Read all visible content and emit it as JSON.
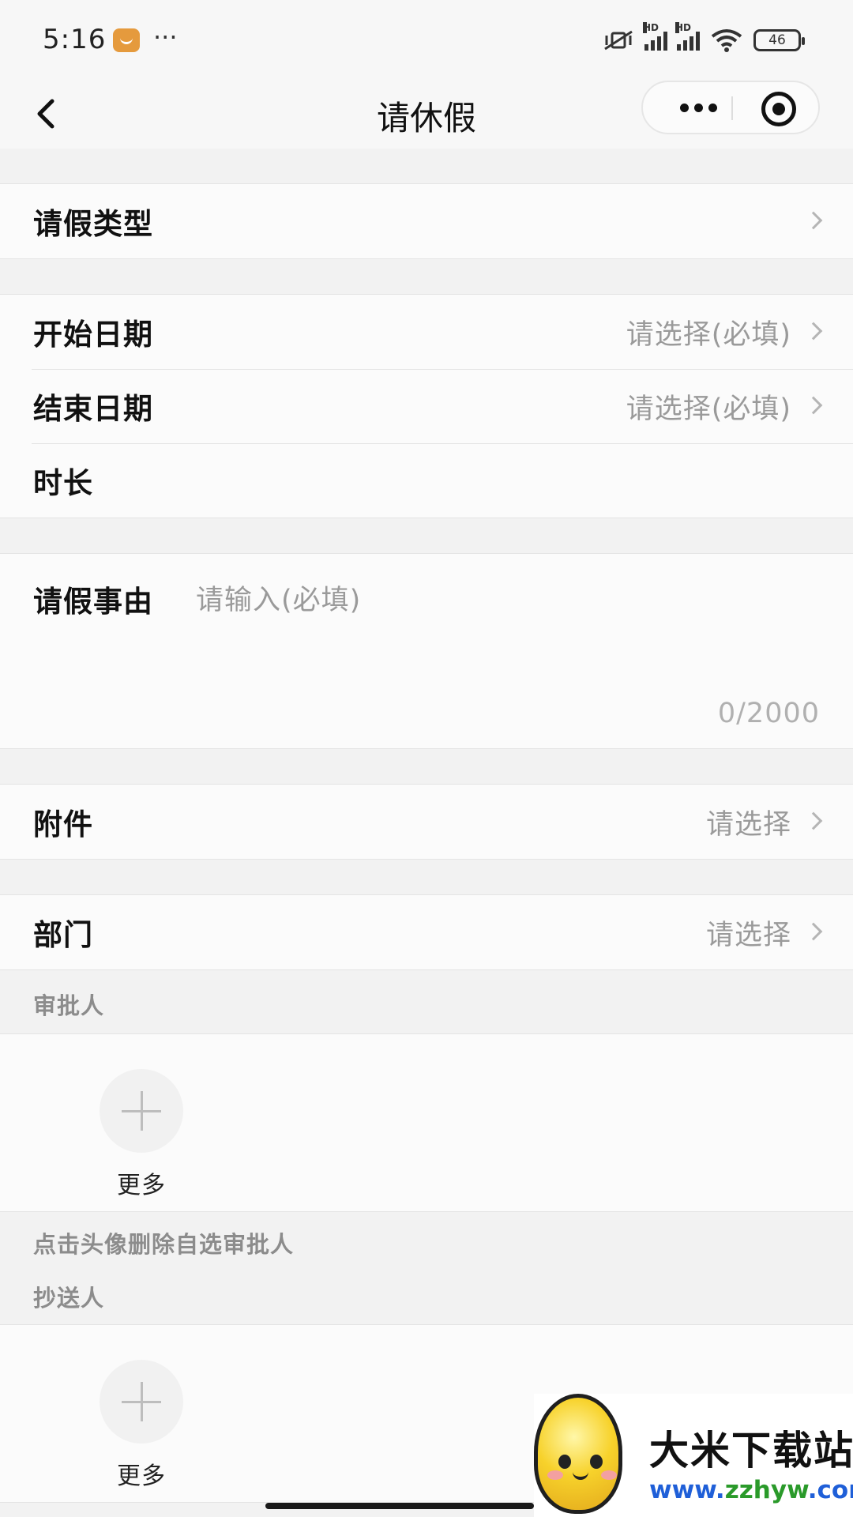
{
  "status_bar": {
    "time": "5:16",
    "dots": "···",
    "battery": "46"
  },
  "nav": {
    "title": "请休假"
  },
  "form": {
    "leave_type": {
      "label": "请假类型"
    },
    "start_date": {
      "label": "开始日期",
      "value": "请选择(必填)"
    },
    "end_date": {
      "label": "结束日期",
      "value": "请选择(必填)"
    },
    "duration": {
      "label": "时长"
    },
    "reason": {
      "label": "请假事由",
      "placeholder": "请输入(必填)",
      "counter": "0/2000"
    },
    "attachment": {
      "label": "附件",
      "value": "请选择"
    },
    "department": {
      "label": "部门",
      "value": "请选择"
    }
  },
  "approvers": {
    "title": "审批人",
    "add_label": "更多",
    "hint": "点击头像删除自选审批人"
  },
  "cc": {
    "title": "抄送人",
    "add_label": "更多"
  },
  "watermark": {
    "title": "大米下载站",
    "url_part1": "www.",
    "url_part2": "zzhyw",
    "url_part3": ".com"
  }
}
